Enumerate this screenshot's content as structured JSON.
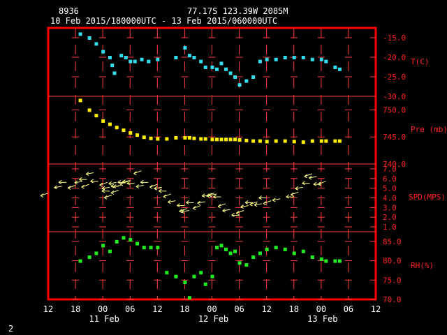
{
  "header": {
    "station_id": "8936",
    "location": "77.17S   123.39W   2085M",
    "period": "10 Feb 2015/180000UTC - 13 Feb 2015/060000UTC"
  },
  "footer": {
    "page_number": "2"
  },
  "colors": {
    "frame": "#ff0000",
    "grid": "#ff4040",
    "text": "#ffffff",
    "temperature": "#33ddee",
    "pressure": "#ffee00",
    "wind": "#ffff88",
    "humidity": "#22ee22"
  },
  "x_axis": {
    "hour_labels": [
      "12",
      "18",
      "00",
      "06",
      "12",
      "18",
      "00",
      "06",
      "12",
      "18",
      "00",
      "06",
      "12"
    ],
    "hour_values": [
      -6,
      0,
      6,
      12,
      18,
      24,
      30,
      36,
      42,
      48,
      54,
      60,
      66
    ],
    "date_labels": [
      {
        "label": "11 Feb",
        "x": 6
      },
      {
        "label": "12 Feb",
        "x": 30
      },
      {
        "label": "13 Feb",
        "x": 54
      }
    ],
    "unit": "hours since 10 Feb 2015 18UTC"
  },
  "chart_data": [
    {
      "type": "scatter",
      "ylabel": "T(C)",
      "ylim": [
        -30,
        -12.5
      ],
      "ticks": [
        "-15.0",
        "-20.0",
        "-25.0",
        "-30.0"
      ],
      "tick_values": [
        -15,
        -20,
        -25,
        -30
      ],
      "x": [
        1,
        3,
        4.5,
        6,
        7.5,
        8,
        8.5,
        10,
        11,
        12,
        13,
        14.5,
        16,
        18,
        22,
        24,
        25,
        26,
        27.5,
        28.5,
        30,
        31,
        32,
        33,
        34,
        35,
        36,
        37.5,
        39,
        40.5,
        42,
        44,
        46,
        48,
        50,
        52,
        54,
        55,
        57,
        58
      ],
      "y": [
        -14,
        -15,
        -16.5,
        -18.5,
        -20,
        -22,
        -24,
        -19.5,
        -20,
        -21,
        -21,
        -20.5,
        -21,
        -20.5,
        -20,
        -17.5,
        -19.5,
        -20,
        -21,
        -22.5,
        -22.5,
        -23,
        -21.5,
        -23,
        -24,
        -25,
        -27,
        -26,
        -25,
        -21,
        -20.5,
        -20.5,
        -20,
        -20,
        -20,
        -20.5,
        -20.5,
        -21,
        -22.5,
        -23
      ]
    },
    {
      "type": "scatter",
      "ylabel": "Pre (mb)",
      "ylim": [
        740,
        752.5
      ],
      "ticks": [
        "740.0",
        "745.0",
        "750.0"
      ],
      "tick_values": [
        740,
        745,
        750
      ],
      "x": [
        1,
        3,
        4.5,
        6,
        7.5,
        9,
        10.5,
        12,
        13.5,
        15,
        16.5,
        18,
        20,
        22,
        24,
        25,
        26,
        27.5,
        28.5,
        30,
        31,
        32,
        33,
        34,
        35,
        36,
        37.5,
        39,
        40.5,
        42,
        44,
        46,
        48,
        50,
        52,
        54,
        55,
        57,
        58
      ],
      "y": [
        751.8,
        750,
        749,
        748,
        747.4,
        746.8,
        746.3,
        745.8,
        745.4,
        745,
        744.8,
        744.7,
        744.7,
        744.9,
        744.9,
        744.9,
        744.8,
        744.7,
        744.7,
        744.6,
        744.6,
        744.6,
        744.6,
        744.6,
        744.6,
        744.5,
        744.4,
        744.3,
        744.3,
        744.2,
        744.3,
        744.3,
        744.2,
        744.1,
        744.3,
        744.3,
        744.3,
        744.3,
        744.3
      ]
    },
    {
      "type": "scatter",
      "ylabel": "SPD(MPS)",
      "ylim": [
        0.5,
        7.5
      ],
      "ticks": [
        "1.0",
        "2.0",
        "3.0",
        "4.0",
        "5.0",
        "6.0",
        "7.0"
      ],
      "tick_values": [
        1,
        2,
        3,
        4,
        5,
        6,
        7
      ],
      "marker": "wind-arrow",
      "x": [
        -6,
        -3,
        -2,
        0,
        1.5,
        2.5,
        3,
        4,
        5,
        7,
        7.5,
        7.5,
        8,
        9,
        9.5,
        9.5,
        10,
        11,
        11.5,
        12,
        13,
        14.5,
        15,
        16,
        18,
        19,
        20,
        21,
        22,
        24,
        24.5,
        25,
        26,
        27.5,
        28.5,
        29.5,
        30.5,
        31,
        32,
        33,
        34,
        36,
        37,
        38,
        39,
        40,
        41,
        42,
        43,
        45,
        48,
        49,
        50,
        51.5,
        52,
        53,
        54,
        55
      ],
      "y": [
        4.5,
        5.2,
        5.6,
        5.3,
        5.7,
        5.9,
        5.4,
        6.6,
        5.7,
        5.6,
        5.1,
        4.7,
        4.3,
        5.6,
        5.2,
        4.8,
        5.3,
        5.6,
        5.7,
        5.8,
        5.5,
        6.8,
        5.3,
        5.6,
        5.4,
        5.1,
        4.7,
        4.4,
        3.7,
        3.2,
        2.9,
        2.7,
        3.5,
        3.2,
        3.6,
        4.2,
        4.5,
        4.4,
        4.1,
        3.4,
        2.8,
        2.2,
        2.7,
        3.2,
        3.5,
        3.6,
        3.4,
        4.0,
        3.7,
        3.9,
        4.1,
        4.6,
        5.1,
        5.5,
        6.5,
        6.2,
        5.4,
        5.7
      ]
    },
    {
      "type": "scatter",
      "ylabel": "RH(%)",
      "ylim": [
        70,
        87.5
      ],
      "ticks": [
        "70.0",
        "75.0",
        "80.0",
        "85.0"
      ],
      "tick_values": [
        70,
        75,
        80,
        85
      ],
      "x": [
        1,
        3,
        4.5,
        6,
        7.5,
        9,
        10.5,
        12,
        13.5,
        15,
        16.5,
        18,
        20,
        22,
        24,
        25,
        26,
        27.5,
        28.5,
        30,
        31,
        32,
        33,
        34,
        35,
        36,
        37.5,
        39,
        40.5,
        42,
        44,
        46,
        48,
        50,
        52,
        54,
        55,
        57,
        58
      ],
      "y": [
        80,
        81,
        82,
        84,
        82.5,
        85,
        86,
        85.5,
        84.5,
        83.5,
        83.5,
        83.5,
        77,
        76,
        74.5,
        70.5,
        76,
        77,
        74,
        76,
        83.5,
        84,
        83,
        82,
        82.5,
        79.5,
        79,
        81,
        82,
        83,
        83.5,
        83,
        82,
        82.5,
        81,
        80.5,
        80,
        80,
        80
      ]
    }
  ]
}
